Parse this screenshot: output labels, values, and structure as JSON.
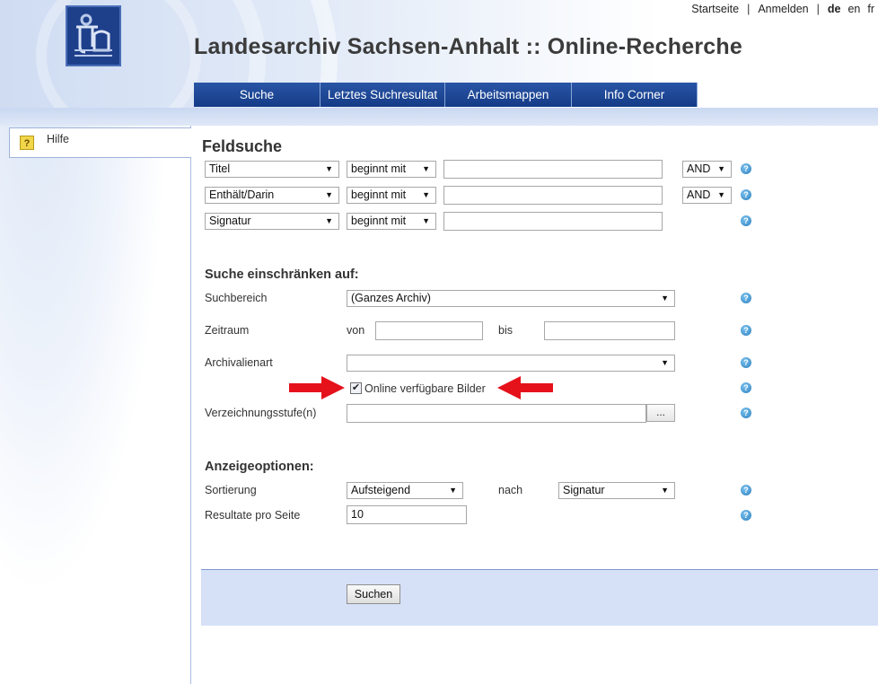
{
  "top_links": {
    "home": "Startseite",
    "sep1": "|",
    "login": "Anmelden",
    "sep2": "|",
    "lang_de": "de",
    "lang_en": "en",
    "lang_fr": "fr"
  },
  "header": {
    "title": "Landesarchiv Sachsen-Anhalt :: Online-Recherche"
  },
  "nav": {
    "tabs": [
      {
        "label": "Suche"
      },
      {
        "label": "Letztes Suchresultat"
      },
      {
        "label": "Arbeitsmappen"
      },
      {
        "label": "Info Corner"
      }
    ]
  },
  "sidebar": {
    "help_label": "Hilfe",
    "help_icon": "?"
  },
  "form": {
    "title": "Feldsuche",
    "rows": [
      {
        "field": "Titel",
        "operator": "beginnt mit",
        "value": "",
        "logic": "AND"
      },
      {
        "field": "Enthält/Darin",
        "operator": "beginnt mit",
        "value": "",
        "logic": "AND"
      },
      {
        "field": "Signatur",
        "operator": "beginnt mit",
        "value": "",
        "logic": ""
      }
    ],
    "restrict": {
      "heading": "Suche einschränken auf:",
      "scope_label": "Suchbereich",
      "scope_value": "(Ganzes Archiv)",
      "period_label": "Zeitraum",
      "from_label": "von",
      "to_label": "bis",
      "from_value": "",
      "to_value": "",
      "type_label": "Archivalienart",
      "type_value": "",
      "images_label": "Online verfügbare Bilder",
      "images_checked": true,
      "level_label": "Verzeichnungsstufe(n)",
      "level_value": "",
      "level_button": "..."
    },
    "display": {
      "heading": "Anzeigeoptionen:",
      "sort_label": "Sortierung",
      "sort_value": "Aufsteigend",
      "by_label": "nach",
      "by_value": "Signatur",
      "per_page_label": "Resultate pro Seite",
      "per_page_value": "10"
    },
    "submit": "Suchen"
  },
  "help_q": "?",
  "colors": {
    "nav_bg": "#1a468f",
    "footer_bg": "#d6e1f7",
    "arrow_red": "#e5121b"
  }
}
